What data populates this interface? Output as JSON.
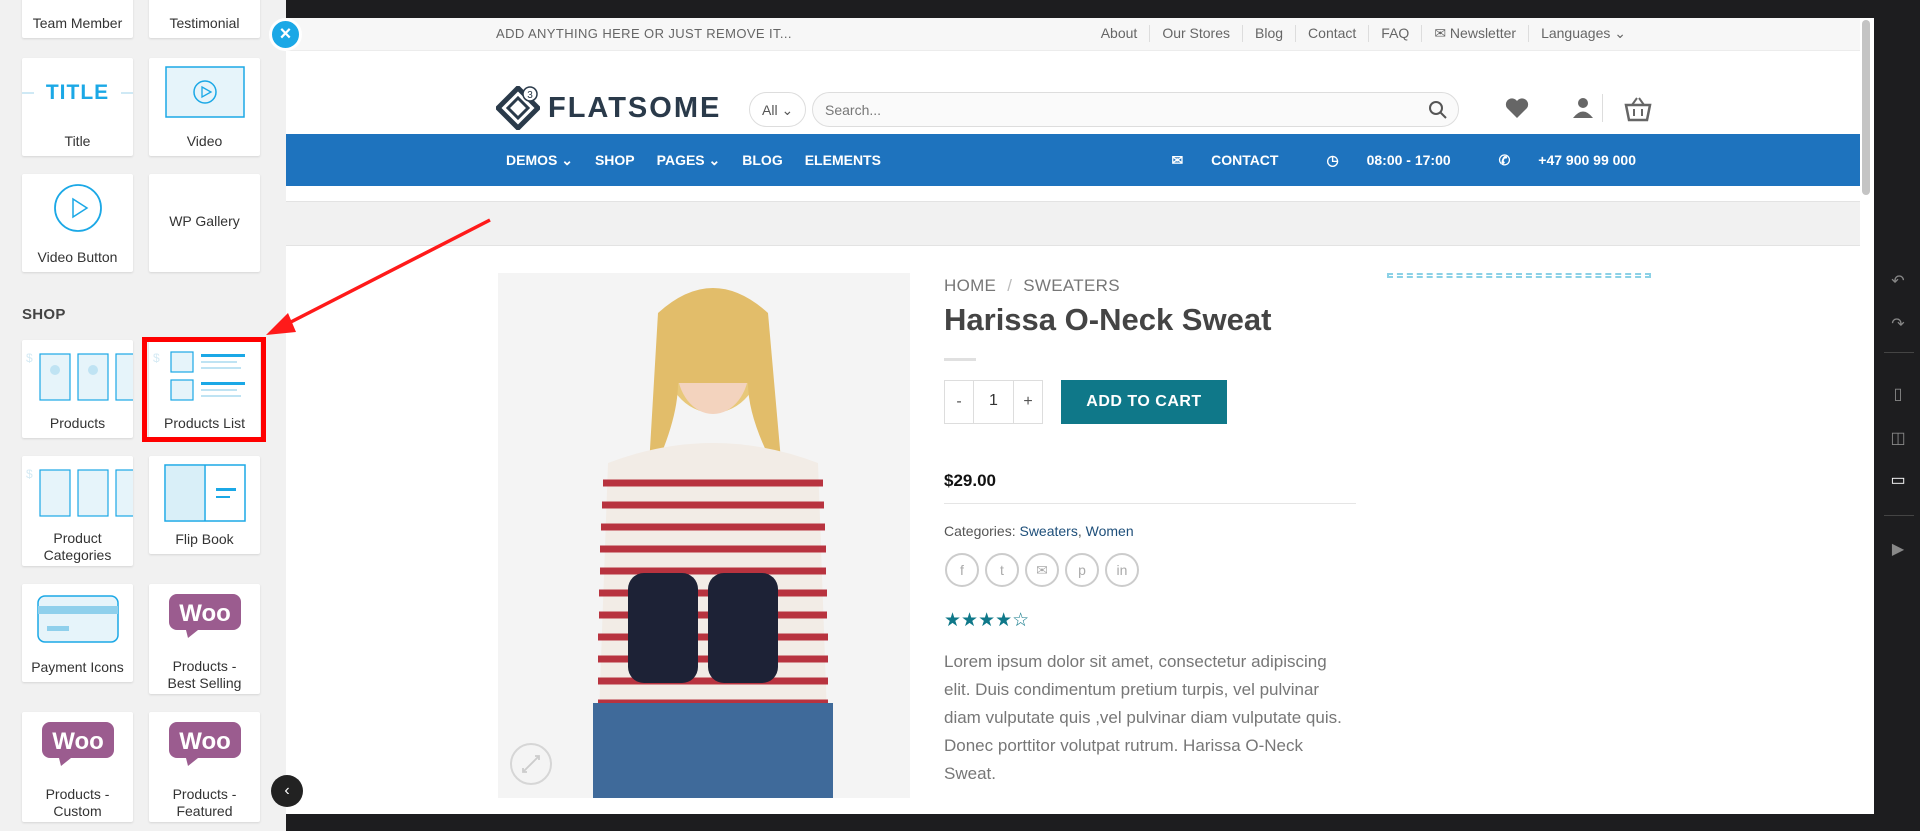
{
  "panel": {
    "close_icon": "×",
    "section_shop": "SHOP",
    "tiles": {
      "team_member": "Team Member",
      "testimonial": "Testimonial",
      "title": "Title",
      "title_thumb": "TITLE",
      "video": "Video",
      "video_button": "Video Button",
      "wp_gallery": "WP Gallery",
      "products": "Products",
      "products_list": "Products List",
      "product_categories_l1": "Product",
      "product_categories_l2": "Categories",
      "flip_book": "Flip Book",
      "payment_icons": "Payment Icons",
      "best_selling_l1": "Products -",
      "best_selling_l2": "Best Selling",
      "custom_l1": "Products -",
      "custom_l2": "Custom",
      "featured_l1": "Products -",
      "featured_l2": "Featured",
      "woo": "Woo"
    },
    "highlight_color": "#ff0000"
  },
  "site": {
    "topbar": {
      "promo": "ADD ANYTHING HERE OR JUST REMOVE IT...",
      "links": [
        "About",
        "Our Stores",
        "Blog",
        "Contact",
        "FAQ",
        "✉ Newsletter",
        "Languages ⌄"
      ]
    },
    "logo": {
      "mark": "3",
      "text": "FLATSOME"
    },
    "search": {
      "category": "All",
      "placeholder": "Search..."
    },
    "nav": {
      "left": [
        "DEMOS ⌄",
        "SHOP",
        "PAGES ⌄",
        "BLOG",
        "ELEMENTS"
      ],
      "contact": "CONTACT",
      "hours": "08:00 - 17:00",
      "phone": "+47 900 99 000"
    },
    "accent_color": "#1e73be",
    "button_color": "#0f7889"
  },
  "product": {
    "breadcrumb_home": "HOME",
    "breadcrumb_sep": "/",
    "breadcrumb_cat": "SWEATERS",
    "title": "Harissa O-Neck Sweat",
    "qty_minus": "-",
    "qty_value": "1",
    "qty_plus": "+",
    "add_to_cart": "ADD TO CART",
    "price": "$29.00",
    "categories_label": "Categories:",
    "categories": [
      "Sweaters",
      "Women"
    ],
    "share_icons": [
      "f",
      "t",
      "✉",
      "p",
      "in"
    ],
    "rating": 4,
    "rating_max": 5,
    "stars": "★★★★☆",
    "description": "Lorem ipsum dolor sit amet, consectetur adipiscing elit. Duis condimentum pretium turpis, vel pulvinar diam vulputate quis ,vel pulvinar diam vulputate quis. Donec porttitor volutpat rutrum. Harissa O-Neck Sweat."
  }
}
